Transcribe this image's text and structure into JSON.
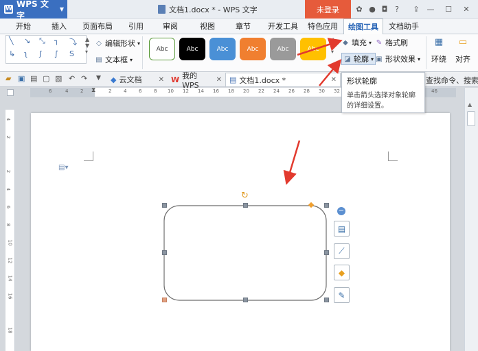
{
  "app": {
    "name": "WPS 文字",
    "doc_title": "文档1.docx * - WPS 文字",
    "login_label": "未登录"
  },
  "menu_tabs": [
    "开始",
    "插入",
    "页面布局",
    "引用",
    "审阅",
    "视图",
    "章节",
    "开发工具",
    "特色应用",
    "绘图工具",
    "文档助手"
  ],
  "ribbon": {
    "edit_shape": "编辑形状",
    "text_box": "文本框",
    "style_samples": [
      "Abc",
      "Abc",
      "Abc",
      "Abc",
      "Abc",
      "Abc"
    ],
    "style_colors": [
      "#ffffff",
      "#000000",
      "#4a90d6",
      "#f07f30",
      "#9a9a9a",
      "#ffc000"
    ],
    "fill": "填充",
    "format_painter": "格式刷",
    "outline": "轮廓",
    "shape_effect": "形状效果",
    "wrap": "环绕",
    "align": "对齐"
  },
  "doc_tabs": [
    "云文档",
    "我的WPS",
    "文档1.docx *"
  ],
  "search_hint": "查找命令、搜索模板",
  "tooltip": {
    "title": "形状轮廓",
    "desc_line1": "单击箭头选择对象轮廓",
    "desc_line2": "的详细设置。"
  },
  "ruler_h": [
    "6",
    "4",
    "2",
    "2",
    "4",
    "6",
    "8",
    "10",
    "12",
    "14",
    "16",
    "18",
    "20",
    "22",
    "24",
    "26",
    "28",
    "30",
    "32",
    "46"
  ],
  "ruler_v": [
    "4",
    "2",
    "2",
    "4",
    "6",
    "8",
    "10",
    "12",
    "14",
    "16",
    "18"
  ],
  "colors": {
    "accent": "#2764b6",
    "login": "#e65b3b",
    "arrow": "#e23a2e"
  }
}
